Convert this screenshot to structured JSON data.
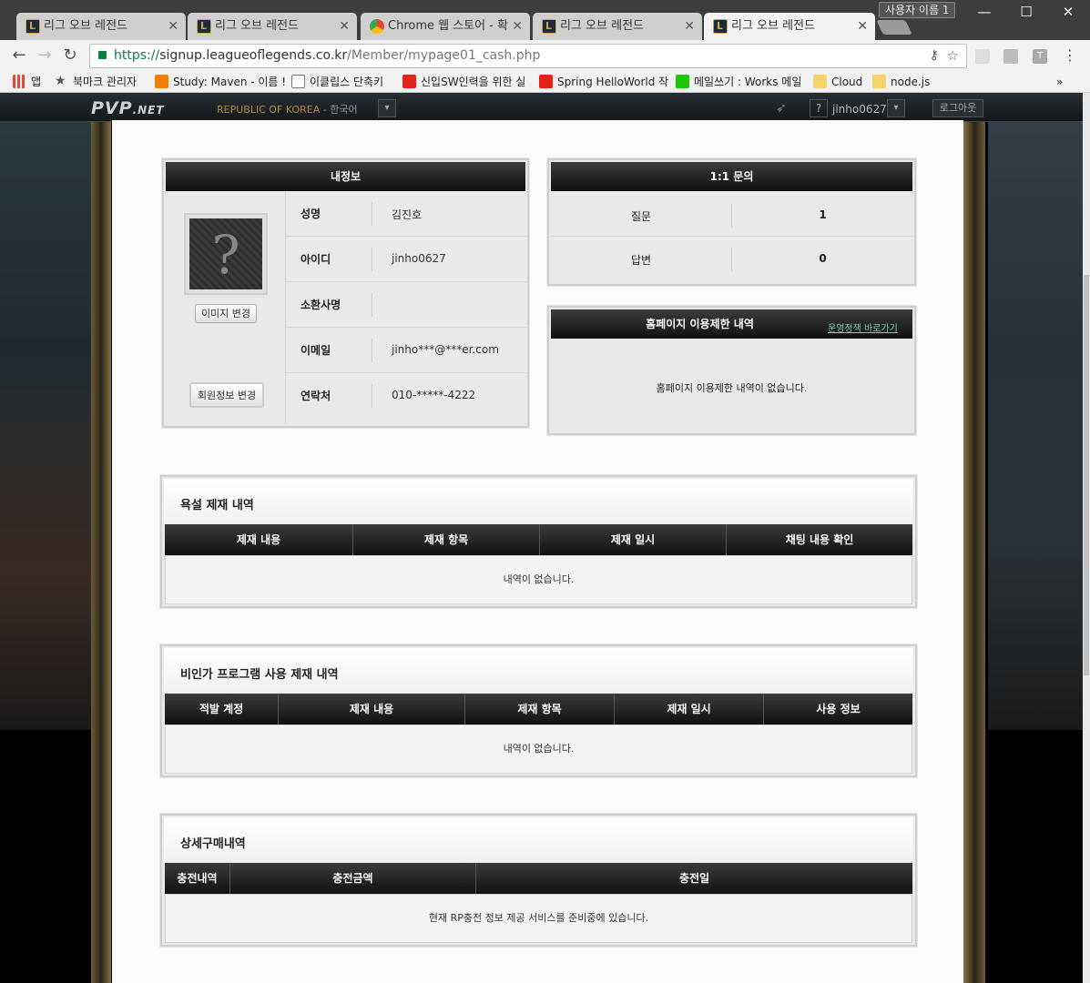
{
  "browser": {
    "tabs": [
      {
        "title": "리그 오브 레전드",
        "active": false,
        "icon": "lol-icon"
      },
      {
        "title": "리그 오브 레전드",
        "active": false,
        "icon": "lol-icon"
      },
      {
        "title": "Chrome 웹 스토어 - 확",
        "active": false,
        "icon": "chrome-store-icon"
      },
      {
        "title": "리그 오브 레전드",
        "active": false,
        "icon": "lol-icon"
      },
      {
        "title": "리그 오브 레전드",
        "active": true,
        "icon": "lol-icon"
      }
    ],
    "profile_name": "사용자 이름 1",
    "url_scheme": "https://",
    "url_host": "signup.leagueoflegends.co.kr",
    "url_path": "/Member/mypage01_cash.php",
    "bookmarks": [
      {
        "label": "앱",
        "icon": "apps-grid-icon",
        "color": "#e04a3a"
      },
      {
        "label": "북마크 관리자",
        "icon": "star-icon",
        "color": "#555555"
      },
      {
        "label": "Study: Maven - 이름 !",
        "icon": "blogger-icon",
        "color": "#f57d00"
      },
      {
        "label": "이클립스 단축키",
        "icon": "page-icon",
        "color": "#ffffff"
      },
      {
        "label": "신입SW인력을 위한 실",
        "icon": "youtube-icon",
        "color": "#e62117"
      },
      {
        "label": "Spring HelloWorld 작",
        "icon": "youtube-icon",
        "color": "#e62117"
      },
      {
        "label": "메일쓰기 : Works 메일",
        "icon": "mail-icon",
        "color": "#1ec800"
      },
      {
        "label": "Cloud",
        "icon": "folder-icon",
        "color": "#f7d26a"
      },
      {
        "label": "node.js",
        "icon": "folder-icon",
        "color": "#f7d26a"
      }
    ],
    "bookmarks_more": "»"
  },
  "pvp": {
    "logo": "PVP",
    "logo_suffix": ".NET",
    "region": "REPUBLIC OF KOREA",
    "region_sep": " - ",
    "language": "한국어",
    "help": "?",
    "username": "jinho0627",
    "logout": "로그아웃"
  },
  "myinfo": {
    "title": "내정보",
    "avatar_placeholder": "?",
    "change_image_button": "이미지 변경",
    "edit_member_button": "회원정보 변경",
    "rows": [
      {
        "label": "성명",
        "value": "김진호"
      },
      {
        "label": "아이디",
        "value": "jinho0627"
      },
      {
        "label": "소환사명",
        "value": ""
      },
      {
        "label": "이메일",
        "value": "jinho***@***er.com"
      },
      {
        "label": "연락처",
        "value": "010-*****-4222"
      }
    ]
  },
  "inquiry": {
    "title": "1:1 문의",
    "rows": [
      {
        "label": "질문",
        "value": "1"
      },
      {
        "label": "답변",
        "value": "0"
      }
    ]
  },
  "restriction": {
    "title": "홈페이지 이용제한 내역",
    "policy_link": "운영정책 바로가기",
    "empty": "홈페이지 이용제한 내역이 없습니다."
  },
  "abuse": {
    "title": "욕설 제재 내역",
    "columns": [
      "제재 내용",
      "제재 항목",
      "제재 일시",
      "채팅 내용 확인"
    ],
    "empty": "내역이 없습니다."
  },
  "illegal": {
    "title": "비인가 프로그램 사용 제재 내역",
    "columns": [
      "적발 계정",
      "제재 내용",
      "제재 항목",
      "제재 일시",
      "사용 정보"
    ],
    "empty": "내역이 없습니다."
  },
  "purchase": {
    "title": "상세구매내역",
    "columns": [
      "충전내역",
      "충전금액",
      "충전일"
    ],
    "empty": "현재 RP충전 정보 제공 서비스를 준비중에 있습니다."
  }
}
